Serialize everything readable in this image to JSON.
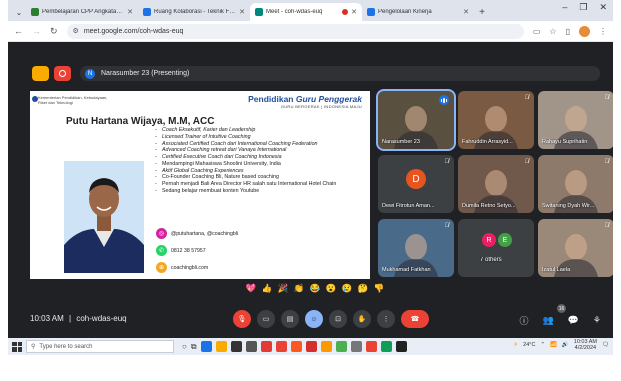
{
  "browser": {
    "tabs": [
      {
        "label": "Pembelajaran CPP Angkatan 11",
        "active": false,
        "color": "#2e7d32"
      },
      {
        "label": "Ruang Kolaborasi - Teknik Facili",
        "active": false,
        "color": "#1a73e8"
      },
      {
        "label": "Meet - coh-wdas-euq",
        "active": true,
        "color": "#00897b"
      },
      {
        "label": "Pengelolaan Kinerja",
        "active": false,
        "color": "#1a73e8"
      }
    ],
    "url": "meet.google.com/coh-wdas-euq"
  },
  "meet": {
    "presenting_initial": "N",
    "presenting_label": "Narasumber 23 (Presenting)",
    "clock": "10:03 AM",
    "separator": "|",
    "meeting_code": "coh-wdas-euq",
    "participant_count": "16"
  },
  "slide": {
    "org_line1": "Kementerian Pendidikan, Kebudayaan,",
    "org_line2": "Riset dan Teknologi",
    "brand_title_a": "Pendidikan",
    "brand_title_b": "Guru Penggerak",
    "brand_subtitle": "GURU BERGERAK | INDONESIA MAJU",
    "speaker_name": "Putu Hartana Wijaya, M.M, ACC",
    "bullets": [
      {
        "text": "Coach Eksekutif, Karier dan Leadership",
        "italic": true
      },
      {
        "text": "Licensed Trainer of Intuitive Coaching",
        "italic": true
      },
      {
        "text": "Associated Certified Coach dari International Coaching Federation",
        "italic": true
      },
      {
        "text": "Advanced Coaching retreat dari Vanaya International",
        "italic": true
      },
      {
        "text": "Certified Executive Coach dari Coaching Indonesia",
        "italic": true
      },
      {
        "text": "Mendampingi Mahasiswa Shoolini University, India",
        "italic": false
      },
      {
        "text": "Aktif Global Coaching Experiences",
        "italic": true
      },
      {
        "text": "Co-Founder Coaching Bli, Nature based coaching",
        "italic": false
      },
      {
        "text": "Pernah menjadi Bali Area Director HR salah satu International Hotel Chain",
        "italic": false
      },
      {
        "text": "Sedang belajar membuat konten Youtube",
        "italic": false
      }
    ],
    "contact_instagram": "@putuhartana, @coachingbli",
    "contact_phone": "0812 38 57957",
    "contact_web": "coachingbli.com"
  },
  "participants": [
    {
      "name": "Narasumber 23",
      "type": "video",
      "bg": "#5a5040",
      "speaking": true
    },
    {
      "name": "Fahruddin Arrasyid...",
      "type": "video",
      "bg": "#7a5a42",
      "speaking": false
    },
    {
      "name": "Rahayu Suprihatin",
      "type": "video",
      "bg": "#a09588",
      "speaking": false
    },
    {
      "name": "Dewi Fitrotun Aman...",
      "type": "avatar",
      "initial": "D",
      "avatar_color": "#e8541f"
    },
    {
      "name": "Dumila Retno Setyo...",
      "type": "video",
      "bg": "#70584a",
      "speaking": false
    },
    {
      "name": "Switaning Dyah Wir...",
      "type": "video",
      "bg": "#8e7a6a",
      "speaking": false
    },
    {
      "name": "Mukhamad Fatkhan",
      "type": "video",
      "bg": "#4a6a8a",
      "speaking": false
    },
    {
      "name": "7 others",
      "type": "others",
      "initials": [
        "R",
        "E"
      ],
      "colors": [
        "#e91e63",
        "#43a047"
      ]
    },
    {
      "name": "Izatul Laela",
      "type": "video",
      "bg": "#9a8878",
      "speaking": false
    }
  ],
  "reactions": [
    "💖",
    "👍",
    "🎉",
    "👏",
    "😂",
    "😮",
    "😢",
    "🤔",
    "👎"
  ],
  "taskbar": {
    "search_placeholder": "Type here to search",
    "weather": "24°C",
    "time": "10:03 AM",
    "date": "4/2/2024"
  },
  "colors": {
    "meet_bg": "#202124",
    "accent_blue": "#8ab4f8",
    "end_call": "#ea4335",
    "brand_blue": "#1f4e9d"
  }
}
